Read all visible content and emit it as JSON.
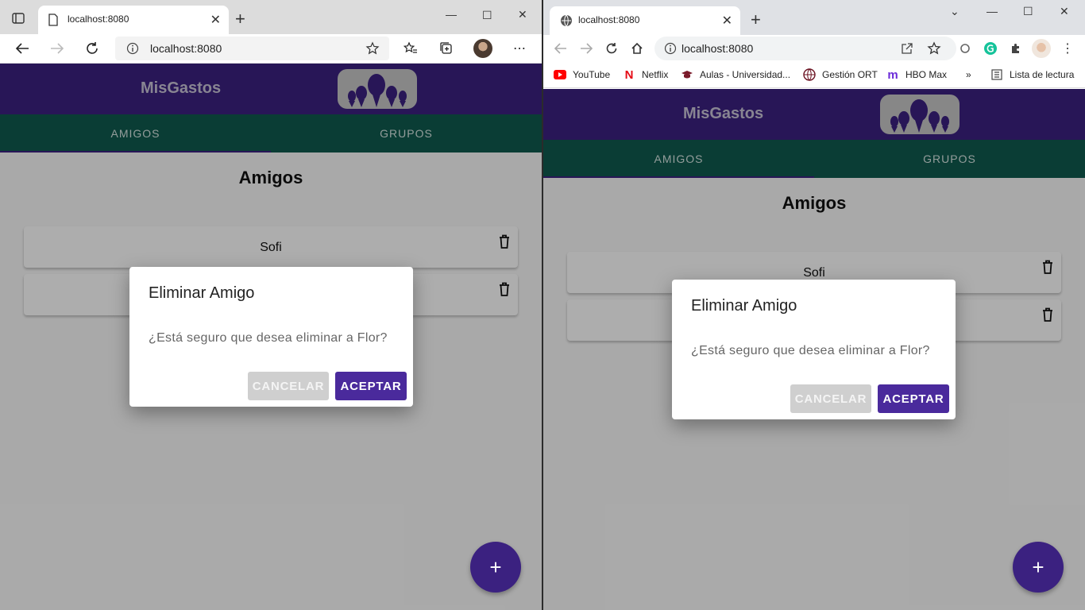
{
  "left_browser": {
    "tab_title": "localhost:8080",
    "url": "localhost:8080"
  },
  "right_browser": {
    "tab_title": "localhost:8080",
    "url": "localhost:8080",
    "bookmarks": [
      "YouTube",
      "Netflix",
      "Aulas - Universidad...",
      "Gestión ORT",
      "HBO Max"
    ],
    "bookmarks_more": "»",
    "reading_list": "Lista de lectura"
  },
  "app": {
    "brand": "MisGastos",
    "tabs": [
      "AMIGOS",
      "GRUPOS"
    ],
    "page_title": "Amigos",
    "friends": [
      "Sofi"
    ],
    "fab_label": "+",
    "dialog": {
      "title": "Eliminar Amigo",
      "text": "¿Está seguro que desea eliminar a Flor?",
      "cancel": "CANCELAR",
      "accept": "ACEPTAR"
    }
  },
  "colors": {
    "primary": "#3b2180",
    "tabs_bg": "#0f5a4e",
    "accept_button": "#4a2a9c",
    "cancel_button": "#cfcfcf"
  }
}
